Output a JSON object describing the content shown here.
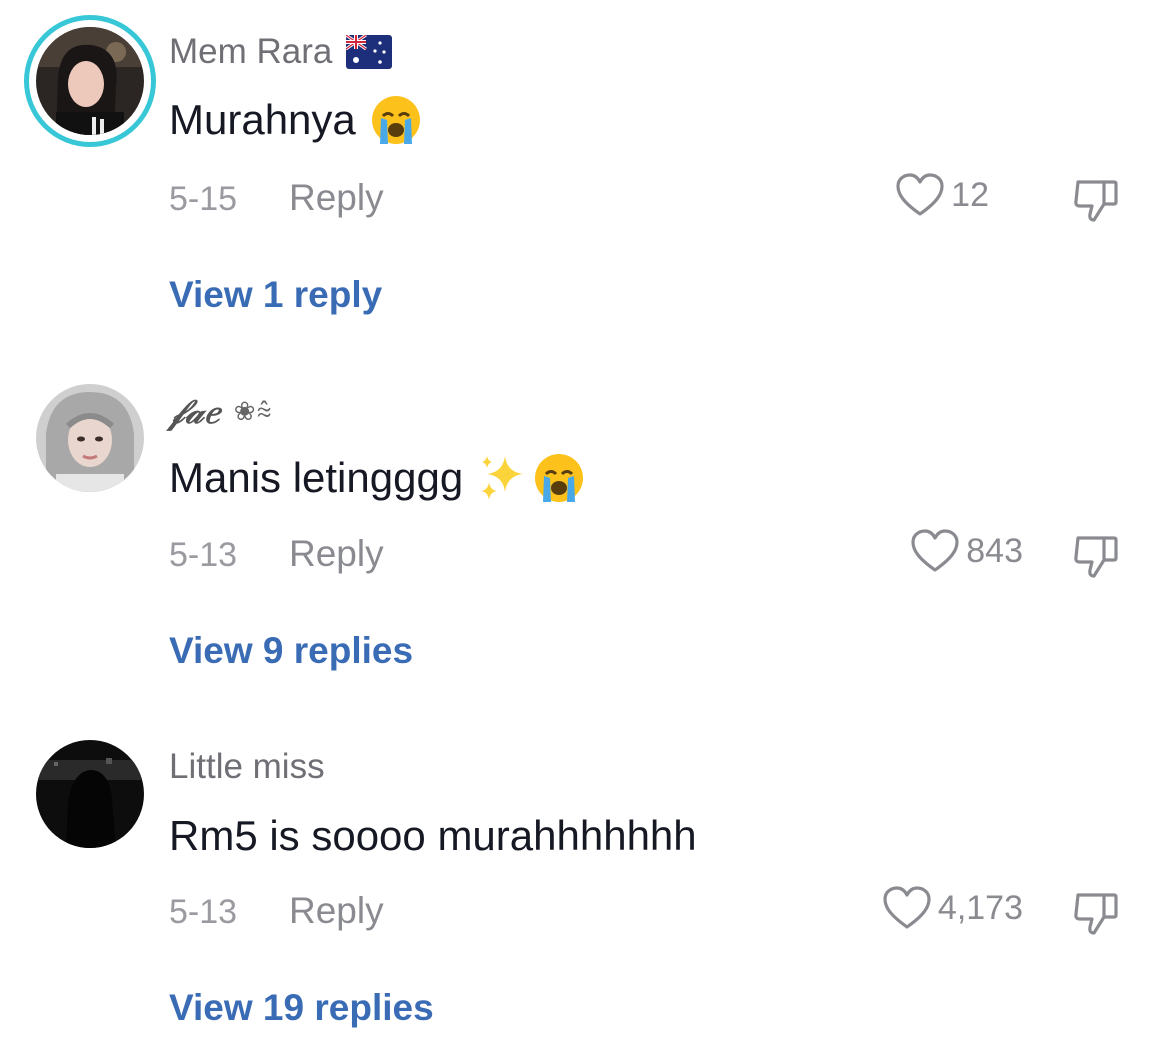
{
  "comments": [
    {
      "username": "Mem Rara",
      "username_flag_icon": "australia-flag-icon",
      "text": "Murahnya",
      "emojis": [
        "loudly-crying-face-icon"
      ],
      "date": "5-15",
      "reply_label": "Reply",
      "likes": "12",
      "view_replies_label": "View 1 reply",
      "avatar_ring_color": "#37c7d6"
    },
    {
      "username": "𝒻𝒶𝑒",
      "username_decoration": "❀⩯",
      "text": "Manis letingggg",
      "emojis": [
        "sparkles-icon",
        "loudly-crying-face-icon"
      ],
      "date": "5-13",
      "reply_label": "Reply",
      "likes": "843",
      "view_replies_label": "View 9 replies"
    },
    {
      "username": "Little miss",
      "text": "Rm5 is soooo murahhhhhhh",
      "date": "5-13",
      "reply_label": "Reply",
      "likes": "4,173",
      "view_replies_label": "View 19 replies"
    }
  ],
  "colors": {
    "link_blue": "#3a6bb5",
    "muted_gray": "#8a8b91",
    "text_dark": "#161823",
    "avatar_ring": "#37c7d6"
  }
}
